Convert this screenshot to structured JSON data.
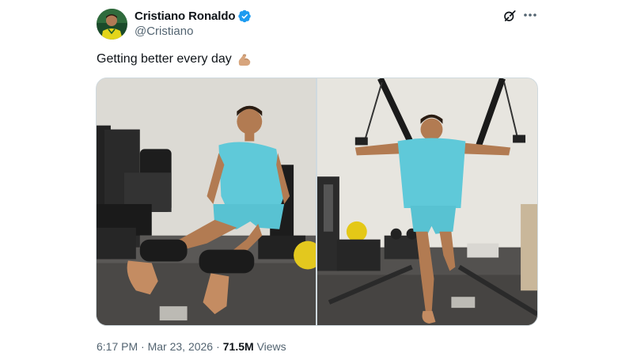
{
  "author": {
    "display_name": "Cristiano Ronaldo",
    "handle": "@Cristiano",
    "verified_badge_color": "#1d9bf0"
  },
  "header_actions": {
    "grok_icon": "grok-icon",
    "more_icon": "more-dots-icon"
  },
  "tweet": {
    "text": "Getting better every day",
    "emoji": "flexed-biceps"
  },
  "media": {
    "photos": [
      {
        "icon": "photo-leg-extension-machine"
      },
      {
        "icon": "photo-cable-crossover"
      }
    ]
  },
  "meta": {
    "time": "6:17 PM",
    "separator1": "·",
    "date": "Mar 23, 2026",
    "separator2": "·",
    "views_count": "71.5M",
    "views_label": "Views"
  },
  "colors": {
    "text_primary": "#0f1419",
    "text_secondary": "#536471",
    "accent": "#1d9bf0"
  }
}
